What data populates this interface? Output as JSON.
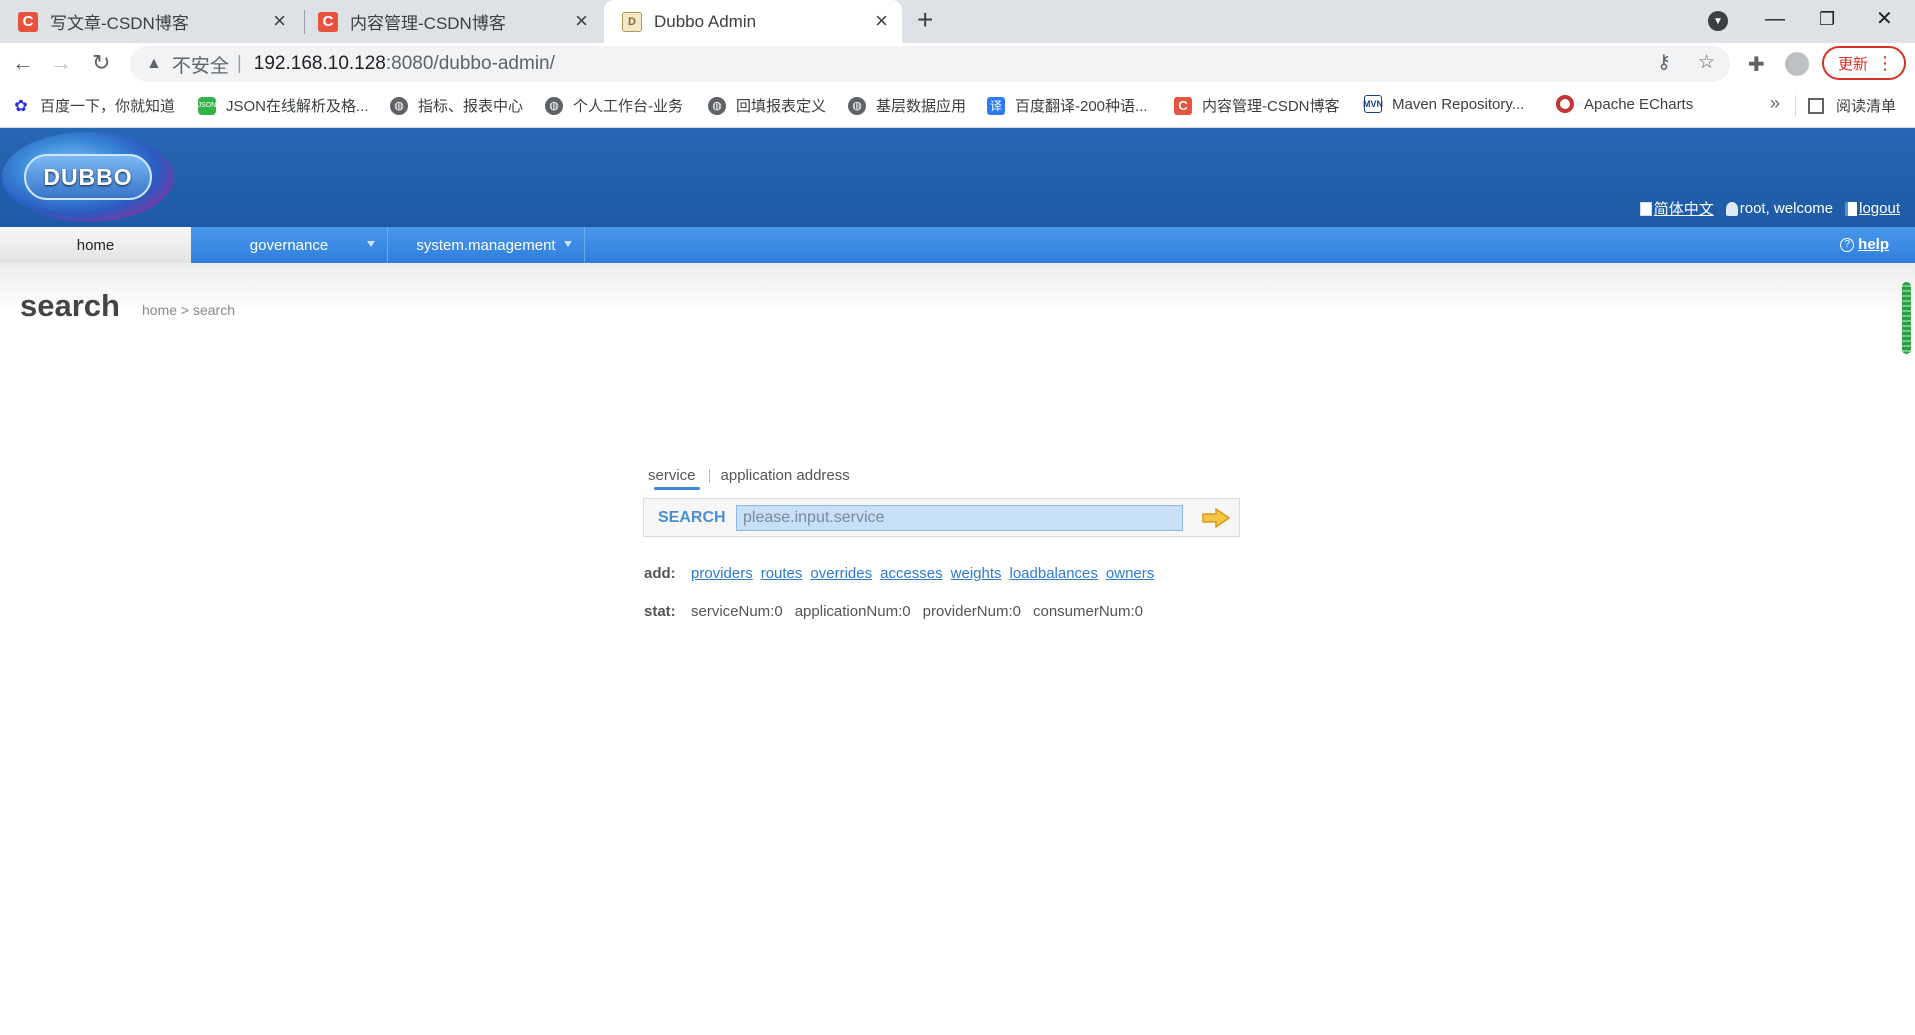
{
  "browser": {
    "tabs": [
      {
        "title": "写文章-CSDN博客",
        "favicon": "C"
      },
      {
        "title": "内容管理-CSDN博客",
        "favicon": "C"
      },
      {
        "title": "Dubbo Admin",
        "favicon": "dubbo-icon"
      }
    ],
    "address": {
      "insecure_label": "不安全",
      "url_host": "192.168.10.128",
      "url_rest": ":8080/dubbo-admin/"
    },
    "update_label": "更新",
    "bookmarks": [
      {
        "label": "百度一下，你就知道",
        "icon": "baidu-icon"
      },
      {
        "label": "JSON在线解析及格...",
        "icon": "json-icon"
      },
      {
        "label": "指标、报表中心",
        "icon": "globe-icon"
      },
      {
        "label": "个人工作台-业务",
        "icon": "globe-icon"
      },
      {
        "label": "回填报表定义",
        "icon": "globe-icon"
      },
      {
        "label": "基层数据应用",
        "icon": "globe-icon"
      },
      {
        "label": "百度翻译-200种语...",
        "icon": "translate-icon"
      },
      {
        "label": "内容管理-CSDN博客",
        "icon": "csdn-icon"
      },
      {
        "label": "Maven Repository...",
        "icon": "mvn-icon"
      },
      {
        "label": "Apache ECharts",
        "icon": "echarts-icon"
      }
    ],
    "reading_list": "阅读清单"
  },
  "header": {
    "logo_text": "DUBBO",
    "language": "简体中文",
    "welcome": "root, welcome",
    "logout": "logout"
  },
  "nav": {
    "items": [
      "home",
      "governance",
      "system.management"
    ],
    "help": "help"
  },
  "page": {
    "title": "search",
    "breadcrumb": "home > search"
  },
  "search": {
    "tabs": [
      "service",
      "application address"
    ],
    "label": "SEARCH",
    "placeholder": "please.input.service"
  },
  "add": {
    "label": "add:",
    "links": [
      "providers",
      "routes",
      "overrides",
      "accesses",
      "weights",
      "loadbalances",
      "owners"
    ]
  },
  "stat": {
    "label": "stat:",
    "values": [
      "serviceNum:0",
      "applicationNum:0",
      "providerNum:0",
      "consumerNum:0"
    ]
  },
  "colors": {
    "header_blue": "#1f5aa6",
    "nav_blue": "#2f7fdc",
    "link_blue": "#2f7ad0",
    "update_red": "#d93025"
  }
}
